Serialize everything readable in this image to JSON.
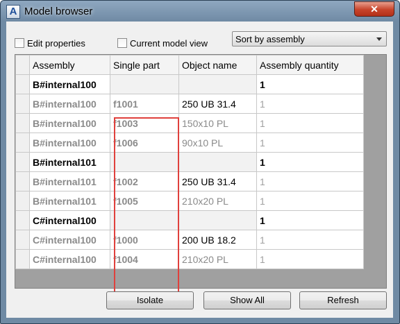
{
  "window": {
    "title": "Model browser",
    "close_label": "✕"
  },
  "options": {
    "edit_properties": {
      "label": "Edit properties",
      "checked": false
    },
    "current_model_view": {
      "label": "Current model view",
      "checked": false
    },
    "sort": {
      "selected": "Sort by assembly"
    }
  },
  "table": {
    "columns": [
      "Assembly",
      "Single part",
      "Object name",
      "Assembly quantity"
    ],
    "rows": [
      {
        "type": "parent",
        "assembly": "B#internal100",
        "single": "",
        "object": "",
        "qty": "1"
      },
      {
        "type": "child",
        "assembly": "B#internal100",
        "single": "f1001",
        "object": "250 UB 31.4",
        "object_style": "primary",
        "qty": "1"
      },
      {
        "type": "child",
        "assembly": "B#internal100",
        "single": "f1003",
        "object": "150x10 PL",
        "object_style": "secondary",
        "qty": "1"
      },
      {
        "type": "child",
        "assembly": "B#internal100",
        "single": "f1006",
        "object": "90x10 PL",
        "object_style": "secondary",
        "qty": "1"
      },
      {
        "type": "parent",
        "assembly": "B#internal101",
        "single": "",
        "object": "",
        "qty": "1"
      },
      {
        "type": "child",
        "assembly": "B#internal101",
        "single": "f1002",
        "object": "250 UB 31.4",
        "object_style": "primary",
        "qty": "1"
      },
      {
        "type": "child",
        "assembly": "B#internal101",
        "single": "f1005",
        "object": "210x20 PL",
        "object_style": "secondary",
        "qty": "1"
      },
      {
        "type": "parent",
        "assembly": "C#internal100",
        "single": "",
        "object": "",
        "qty": "1"
      },
      {
        "type": "child",
        "assembly": "C#internal100",
        "single": "f1000",
        "object": "200 UB 18.2",
        "object_style": "primary",
        "qty": "1"
      },
      {
        "type": "child",
        "assembly": "C#internal100",
        "single": "f1004",
        "object": "210x20 PL",
        "object_style": "secondary",
        "qty": "1"
      }
    ]
  },
  "buttons": {
    "isolate": "Isolate",
    "show_all": "Show All",
    "refresh": "Refresh"
  },
  "colors": {
    "highlight": "#e0403c",
    "title_bar": "#6f8aa4",
    "close": "#c7432a"
  }
}
